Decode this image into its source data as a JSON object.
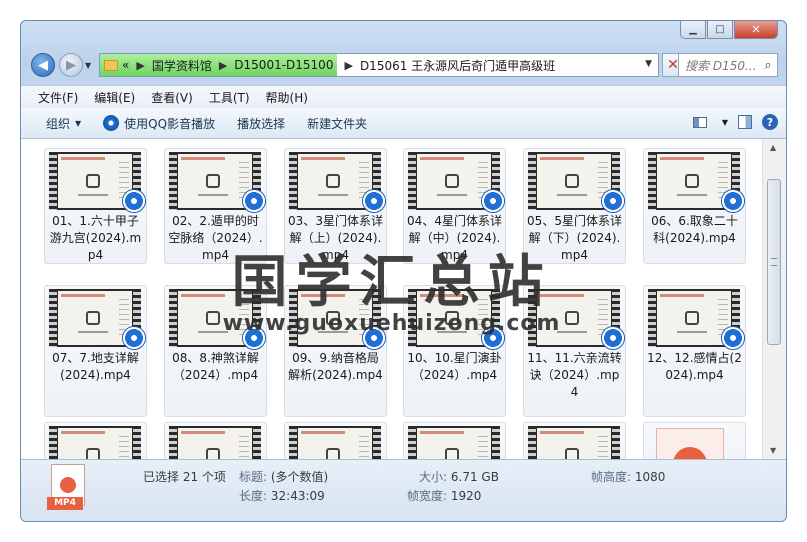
{
  "window": {
    "controls": {
      "minimize": "▁",
      "maximize": "□",
      "close": "✕"
    }
  },
  "address": {
    "overflow": "«",
    "crumbs": [
      "国学资料馆",
      "D15001-D15100",
      "D15061 王永源风后奇门遁甲高级班"
    ],
    "search_placeholder": "搜索 D150..."
  },
  "menu": [
    "文件(F)",
    "编辑(E)",
    "查看(V)",
    "工具(T)",
    "帮助(H)"
  ],
  "commands": {
    "organize": "组织",
    "play_qq": "使用QQ影音播放",
    "play_select": "播放选择",
    "new_folder": "新建文件夹"
  },
  "files": [
    "01、1.六十甲子游九宫(2024).mp4",
    "02、2.遁甲的时空脉络（2024）.mp4",
    "03、3星门体系详解（上）(2024).mp4",
    "04、4星门体系详解（中）(2024).mp4",
    "05、5星门体系详解（下）(2024).mp4",
    "06、6.取象二十科(2024).mp4",
    "07、7.地支详解(2024).mp4",
    "08、8.神煞详解（2024）.mp4",
    "09、9.纳音格局解析(2024).mp4",
    "10、10.星门演卦（2024）.mp4",
    "11、11.六亲流转诀（2024）.mp4",
    "12、12.感情占(2024).mp4"
  ],
  "watermark": {
    "title": "国学汇总站",
    "url": "www.guoxuehuizong.com"
  },
  "details": {
    "file_type": "MP4",
    "selected": "已选择 21 个项",
    "title_label": "标题:",
    "title_value": "(多个数值)",
    "length_label": "长度:",
    "length_value": "32:43:09",
    "size_label": "大小:",
    "size_value": "6.71 GB",
    "frame_width_label": "帧宽度:",
    "frame_width_value": "1920",
    "frame_height_label": "帧高度:",
    "frame_height_value": "1080"
  }
}
